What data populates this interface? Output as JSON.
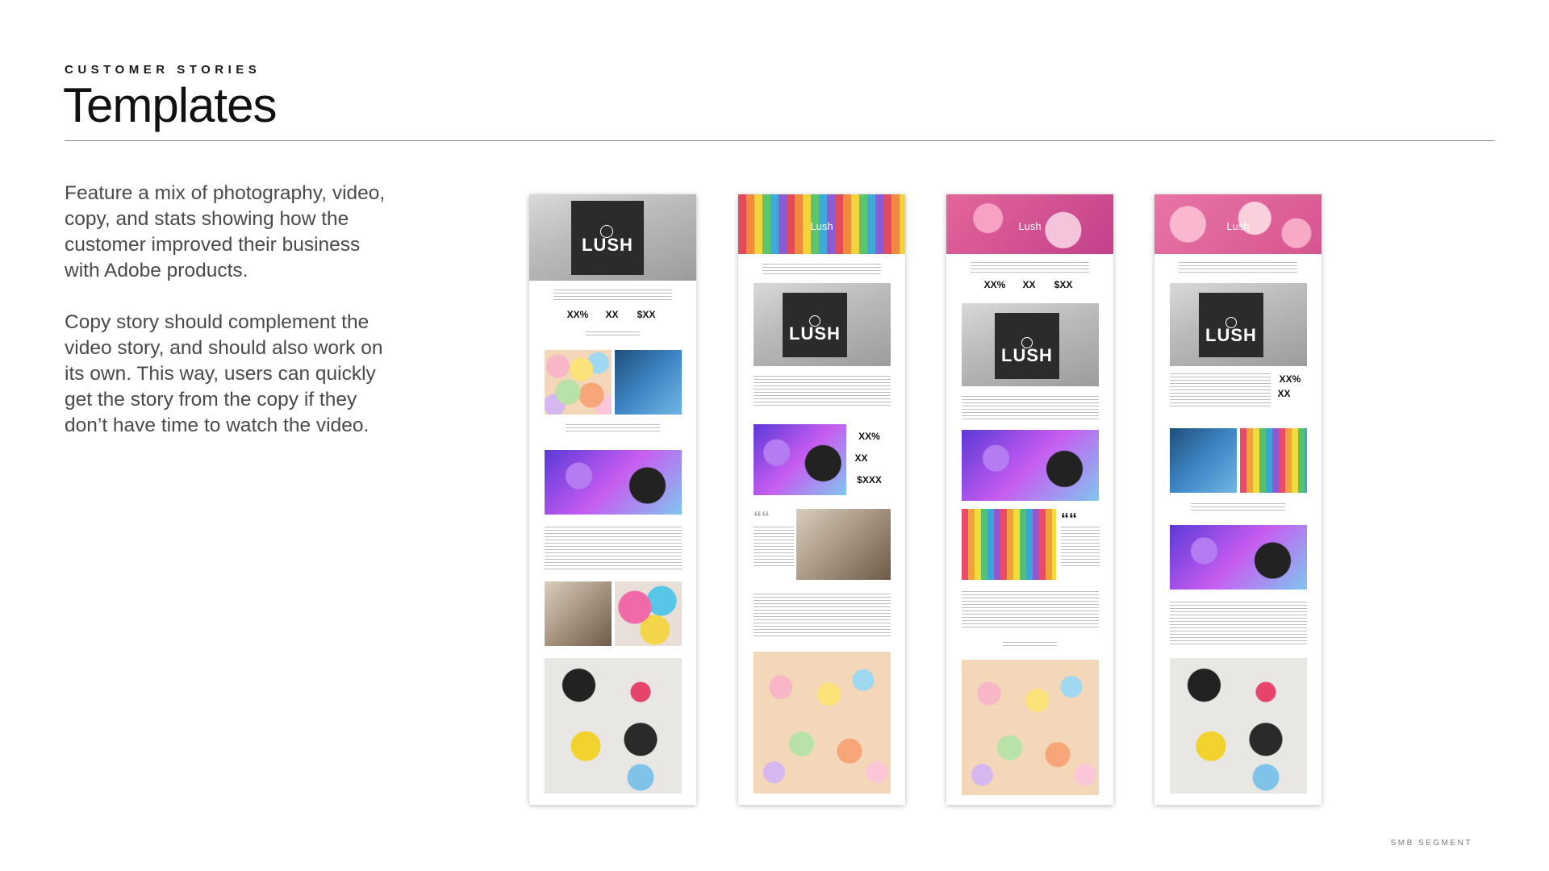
{
  "header": {
    "eyebrow": "CUSTOMER STORIES",
    "title": "Templates"
  },
  "copy": {
    "paragraph_1": "Feature a mix of photography, video, copy, and stats showing how the customer improved their business with Adobe products.",
    "paragraph_2": "Copy story should complement the video story, and should also work on its own. This way, users can quickly get the story from the copy if they don’t have time to watch the video."
  },
  "footer": {
    "label": "SMB SEGMENT"
  },
  "templates": {
    "brand": "LUSH",
    "hero_brand": "Lush",
    "stat_1": "XX%",
    "stat_2": "XX",
    "stat_3": "$XX",
    "stat_3b": "$XXX",
    "quote_mark": "““"
  },
  "colors": {
    "rule": "#8a8a8a",
    "body_text": "#4a4a4a",
    "heading": "#111111"
  }
}
